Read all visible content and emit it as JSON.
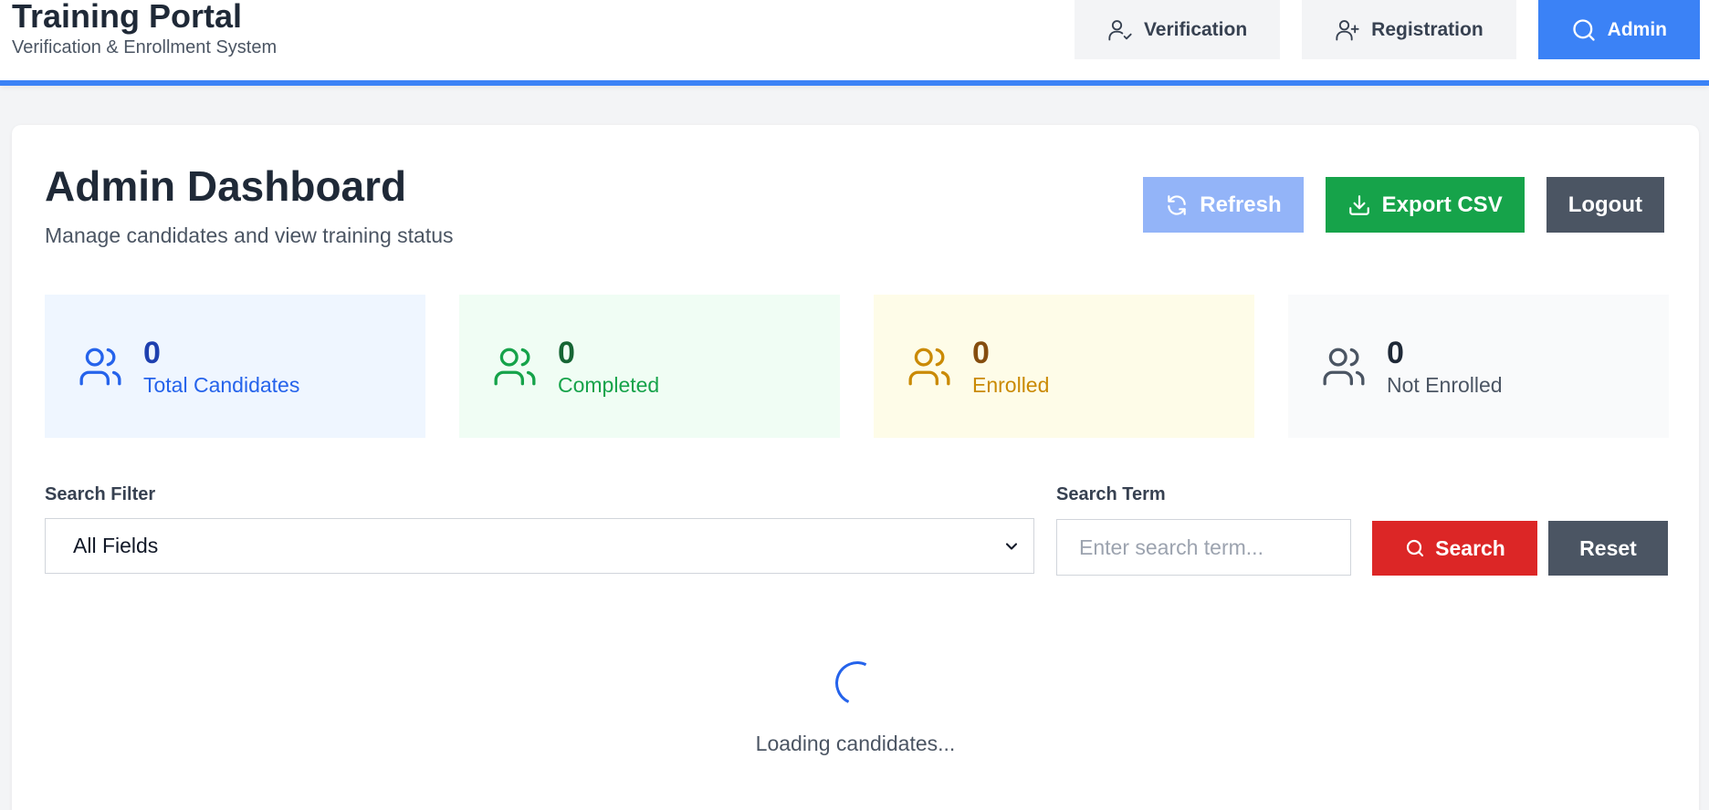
{
  "header": {
    "title": "Training Portal",
    "subtitle": "Verification & Enrollment System",
    "nav": [
      {
        "label": "Verification",
        "icon": "user-check-icon"
      },
      {
        "label": "Registration",
        "icon": "user-plus-icon"
      },
      {
        "label": "Admin",
        "icon": "search-icon",
        "active": true
      }
    ]
  },
  "dashboard": {
    "title": "Admin Dashboard",
    "subtitle": "Manage candidates and view training status",
    "actions": {
      "refresh": "Refresh",
      "export": "Export CSV",
      "logout": "Logout"
    }
  },
  "stats": [
    {
      "value": "0",
      "label": "Total Candidates",
      "color": "#2563eb"
    },
    {
      "value": "0",
      "label": "Completed",
      "color": "#16a34a"
    },
    {
      "value": "0",
      "label": "Enrolled",
      "color": "#ca8a04"
    },
    {
      "value": "0",
      "label": "Not Enrolled",
      "color": "#4b5563"
    }
  ],
  "search": {
    "filter_label": "Search Filter",
    "filter_value": "All Fields",
    "term_label": "Search Term",
    "term_placeholder": "Enter search term...",
    "search_button": "Search",
    "reset_button": "Reset"
  },
  "loading": {
    "text": "Loading candidates..."
  },
  "colors": {
    "accent": "#3b82f6",
    "export": "#16a34a",
    "search": "#dc2626",
    "neutral": "#4b5563"
  }
}
